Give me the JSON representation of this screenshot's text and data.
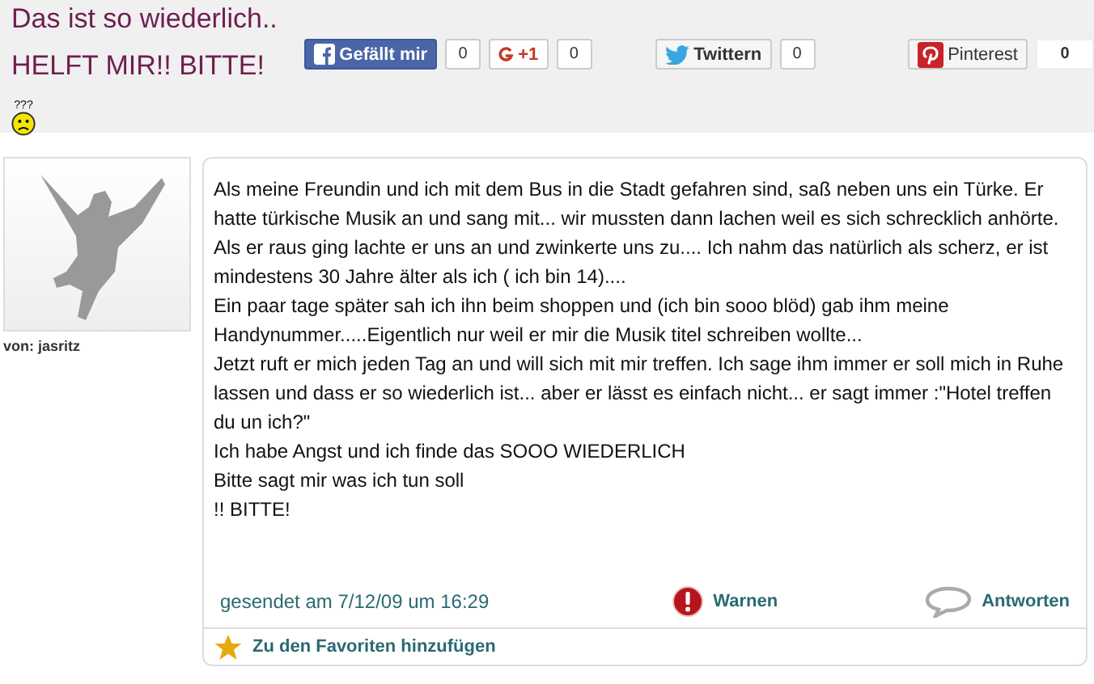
{
  "title": {
    "text": "Das ist so wiederlich.. HELFT MIR!! BITTE!",
    "emoticon_caption": "???"
  },
  "share": [
    {
      "kind": "facebook",
      "label": "Gefällt mir",
      "count": "0"
    },
    {
      "kind": "gplus",
      "label": "+1",
      "count": "0"
    },
    {
      "kind": "twitter",
      "label": "Twittern",
      "count": "0"
    },
    {
      "kind": "pinterest",
      "label": "Pinterest",
      "count": "0"
    }
  ],
  "post": {
    "author": "von: jasritz",
    "paragraphs": [
      "Als meine Freundin und ich mit dem Bus in die Stadt gefahren sind, saß neben uns ein Türke. Er hatte türkische Musik an und sang mit... wir mussten dann lachen weil es sich schrecklich anhörte. Als er raus ging lachte er uns an und zwinkerte uns zu.... Ich nahm das natürlich als scherz, er ist mindestens 30 Jahre älter als ich ( ich bin 14)....",
      "Ein paar tage später sah ich ihn beim shoppen und (ich bin sooo blöd) gab ihm meine Handynummer.....Eigentlich nur weil er mir die Musik titel schreiben wollte...",
      "Jetzt ruft er mich jeden Tag an und will sich mit mir treffen. Ich sage ihm immer er soll mich in Ruhe lassen und dass er so wiederlich ist... aber er lässt es einfach nicht... er sagt immer :\"Hotel treffen du un ich?\"",
      "Ich habe Angst und ich finde das SOOO WIEDERLICH",
      "Bitte sagt mir was ich tun soll",
      "!! BITTE!"
    ],
    "sent": "gesendet am 7/12/09 um 16:29",
    "actions": [
      {
        "kind": "warn",
        "label": "Warnen"
      },
      {
        "kind": "reply",
        "label": "Antworten"
      }
    ],
    "favorite": "Zu den Favoriten hinzufügen"
  }
}
